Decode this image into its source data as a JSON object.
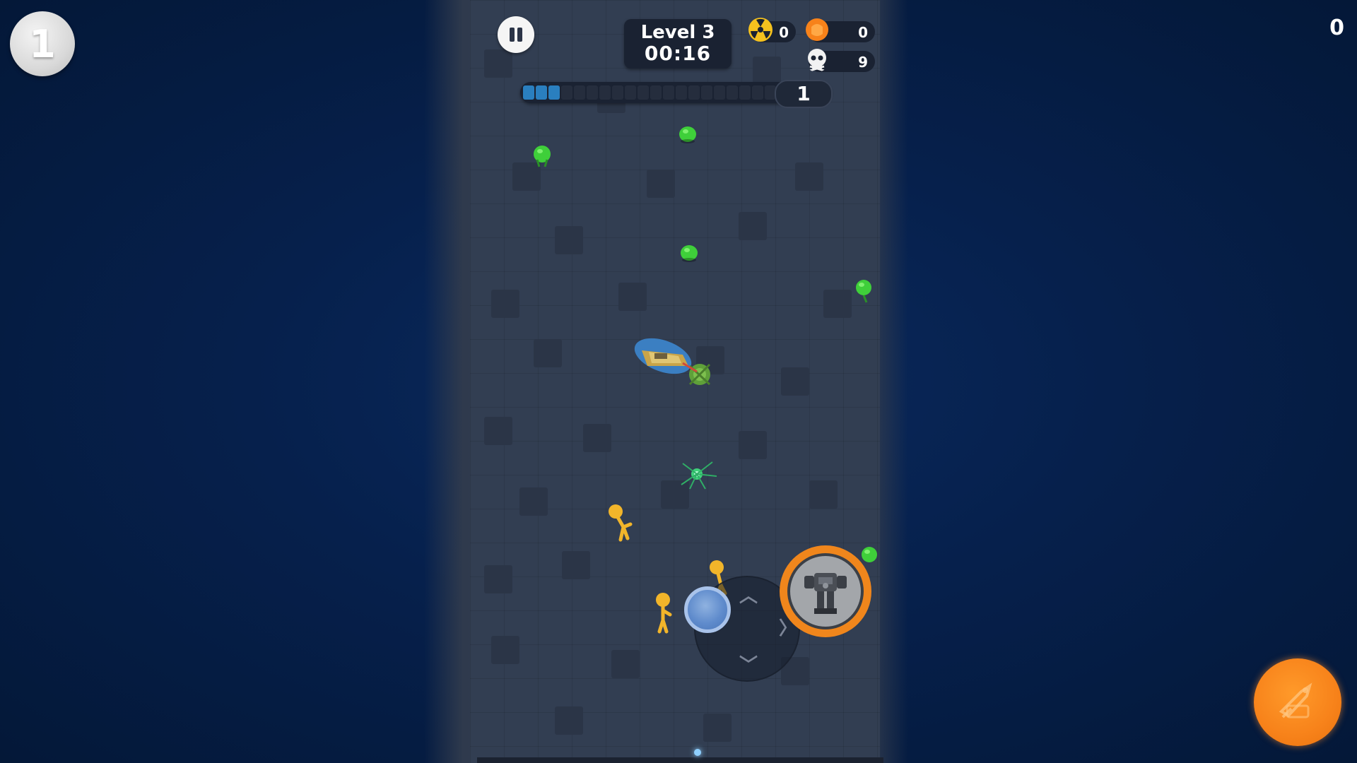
{
  "hud": {
    "level_badge": "1",
    "top_right_counter": "0",
    "level_title": "Level 3",
    "timer": "00:16",
    "radiation_count": "0",
    "coin_count": "0",
    "kill_count": "9",
    "progress_level": "1",
    "progress_fraction": 0.15
  },
  "icons": {
    "pause": "pause-icon",
    "radiation": "radiation-icon",
    "coin": "coin-icon",
    "skull": "skull-icon",
    "mech": "mech-robot-icon",
    "special": "rocket-special-icon"
  },
  "colors": {
    "background": "#06204c",
    "arena": "#323e52",
    "accent_orange": "#f7821a",
    "progress_fill": "#2a7fbf",
    "enemy_green": "#3fcf3a",
    "ally_yellow": "#f2b52a"
  }
}
